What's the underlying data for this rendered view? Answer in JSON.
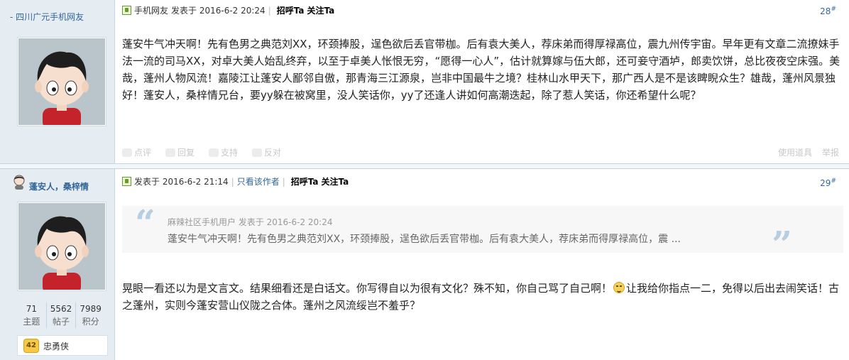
{
  "post1": {
    "author": "- 四川广元手机网友",
    "meta": {
      "source": "手机网友",
      "posted": "发表于 2016-6-2 20:24",
      "greet": "招呼Ta",
      "follow": "关注Ta"
    },
    "floor_num": "28",
    "floor_mark": "#",
    "body": "蓬安牛气冲天啊！先有色男之典范刘XX，环颈捧股，逞色欲后丢官带枷。后有袁大美人，荐床弟而得厚禄高位，震九州传宇宙。早年更有文章二流撩妹手法一流的司马XX，对卓大美人始乱终弃，以至于卓美人怅恨无穷，“愿得一心人”，估计就算嫁与伍大郎，还可妾守酒垆，郎卖饮饼，总比夜夜空床强。美哉，蓬州人物风流！嘉陵江让蓬安人鄙邻自傲，那青海三江源泉，岂非中国最牛之境？桂林山水甲天下，那广西人是不是该睥睨众生？雄哉，蓬州风景独好！蓬安人，桑梓情兄台，要yy躲在被窝里，没人笑话你，yy了还逢人讲如何高潮迭起，除了惹人笑话，你还希望什么呢？",
    "actions": {
      "rate": "点评",
      "reply": "回复",
      "support": "支持",
      "oppose": "反对",
      "use_tool": "使用道具",
      "report": "举报"
    }
  },
  "post2": {
    "author": "蓬安人，桑梓情",
    "meta": {
      "posted": "发表于 2016-6-2 21:14",
      "only_author": "只看该作者",
      "greet": "招呼Ta",
      "follow": "关注Ta"
    },
    "floor_num": "29",
    "floor_mark": "#",
    "quote": {
      "head": "麻辣社区手机用户 发表于 2016-6-2 20:24",
      "text": "蓬安牛气冲天啊！先有色男之典范刘XX，环颈捧股，逞色欲后丢官带枷。后有袁大美人，荐床弟而得厚禄高位，震 ..."
    },
    "body_before": "晃眼一看还以为是文言文。结果细看还是白话文。你写得自以为很有文化？殊不知，你自己骂了自己啊！",
    "body_after": "让我给你指点一二，免得以后出去闹笑话！古之蓬州，实则今蓬安营山仪陇之合体。蓬州之风流绥岂不羞乎？",
    "stats": [
      {
        "value": "71",
        "label": "主题"
      },
      {
        "value": "5562",
        "label": "帖子"
      },
      {
        "value": "7989",
        "label": "积分"
      }
    ],
    "level": {
      "badge": "42",
      "name": "忠勇侠"
    }
  },
  "colors": {
    "sidebar_bg": "#e5edf2",
    "link": "#336699",
    "quote_mark": "#b7cde0"
  },
  "icons": [
    "mobile-user-icon",
    "online-user-icon",
    "laugh-emoji-icon",
    "rate-icon",
    "reply-icon",
    "support-icon",
    "oppose-icon",
    "level-badge-icon"
  ]
}
